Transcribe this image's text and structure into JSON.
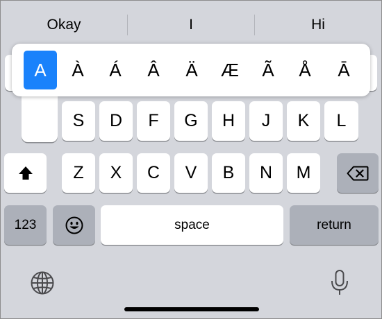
{
  "suggestions": [
    "Okay",
    "I",
    "Hi"
  ],
  "rows": {
    "row2": [
      "S",
      "D",
      "F",
      "G",
      "H",
      "J",
      "K",
      "L"
    ],
    "row3": [
      "Z",
      "X",
      "C",
      "V",
      "B",
      "N",
      "M"
    ]
  },
  "accents": [
    "A",
    "À",
    "Á",
    "Â",
    "Ä",
    "Æ",
    "Ã",
    "Å",
    "Ā"
  ],
  "selected_accent": "A",
  "keys": {
    "numbers_label": "123",
    "space_label": "space",
    "return_label": "return"
  },
  "icons": {
    "shift": "shift-icon",
    "delete": "delete-icon",
    "emoji": "emoji-icon",
    "globe": "globe-icon",
    "mic": "microphone-icon"
  },
  "colors": {
    "keyboard_bg": "#d4d6dc",
    "key_light": "#ffffff",
    "key_dark": "#acb0b9",
    "accent_selected": "#1a82fb"
  }
}
